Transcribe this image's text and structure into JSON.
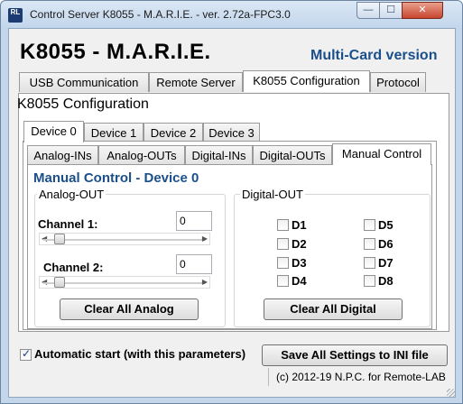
{
  "window": {
    "title": "Control Server K8055 - M.A.R.I.E. - ver. 2.72a-FPC3.0",
    "icon": "RL",
    "buttons": {
      "minimize": "—",
      "maximize": "☐",
      "close": "✕"
    }
  },
  "header": {
    "app_title": "K8055 - M.A.R.I.E.",
    "edition": "Multi-Card version"
  },
  "main_tabs": [
    "USB Communication",
    "Remote Server",
    "K8055 Configuration",
    "Protocol"
  ],
  "main_tab_active": "K8055 Configuration",
  "section_title": "K8055 Configuration",
  "device_tabs": [
    "Device 0",
    "Device 1",
    "Device 2",
    "Device 3"
  ],
  "device_tab_active": "Device 0",
  "sub_tabs": [
    "Analog-INs",
    "Analog-OUTs",
    "Digital-INs",
    "Digital-OUTs",
    "Manual Control"
  ],
  "sub_tab_active": "Manual Control",
  "manual_control": {
    "title": "Manual Control - Device 0",
    "analog_out": {
      "label": "Analog-OUT",
      "channel1": {
        "label": "Channel 1:",
        "value": "0",
        "slider_level": 0
      },
      "channel2": {
        "label": "Channel 2:",
        "value": "0",
        "slider_level": 0
      },
      "clear_button": "Clear All Analog"
    },
    "digital_out": {
      "label": "Digital-OUT",
      "outputs": [
        {
          "label": "D1",
          "checked": false
        },
        {
          "label": "D2",
          "checked": false
        },
        {
          "label": "D3",
          "checked": false
        },
        {
          "label": "D4",
          "checked": false
        },
        {
          "label": "D5",
          "checked": false
        },
        {
          "label": "D6",
          "checked": false
        },
        {
          "label": "D7",
          "checked": false
        },
        {
          "label": "D8",
          "checked": false
        }
      ],
      "clear_button": "Clear All Digital"
    }
  },
  "footer": {
    "auto_start_label": "Automatic start (with this parameters)",
    "auto_start_checked": true,
    "save_button": "Save All Settings to INI file",
    "status": "(c) 2012-19 N.P.C. for Remote-LAB"
  },
  "colors": {
    "accent_blue": "#1b4f8a",
    "window_frame": "#c4d6ea",
    "close_button": "#c8452f"
  }
}
